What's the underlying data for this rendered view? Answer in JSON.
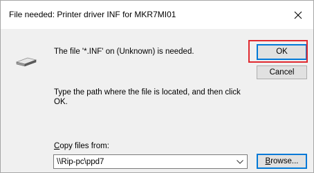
{
  "dialog": {
    "title": "File needed: Printer driver INF for MKR7MI01",
    "message": "The file '*.INF' on (Unknown) is needed.",
    "instruction": "Type the path where the file is located, and then click OK.",
    "copy_label_mnemonic": "C",
    "copy_label_rest": "opy files from:",
    "path_value": "\\\\Rip-pc\\ppd7"
  },
  "buttons": {
    "ok": "OK",
    "cancel": "Cancel",
    "browse_mnemonic": "B",
    "browse_rest": "rowse..."
  },
  "colors": {
    "highlight": "#e0282e",
    "focus": "#0078d7"
  },
  "icons": {
    "close": "close-icon",
    "drive": "drive-icon",
    "dropdown": "chevron-down-icon"
  }
}
